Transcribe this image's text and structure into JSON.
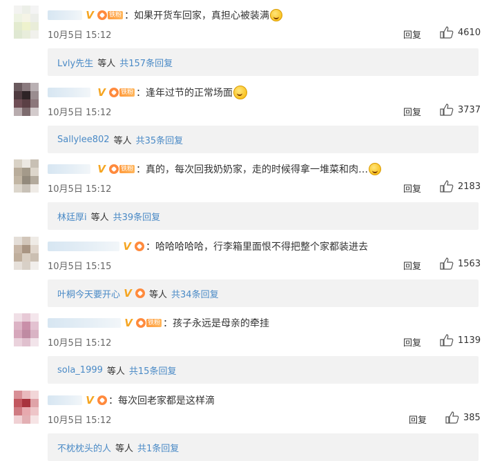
{
  "comments": [
    {
      "text": "：如果开货车回家，真担心被装满",
      "time": "10月5日 15:12",
      "reply_label": "回复",
      "likes": "4610",
      "icons": [
        "verified-v-icon",
        "fan-icon",
        "fan-badge",
        "laugh-cry-emoji-icon"
      ],
      "fan_badge": "铁粉",
      "sub": {
        "user": "Lvly先生",
        "etc": "等人",
        "total": "共157条回复"
      }
    },
    {
      "text": "：逢年过节的正常场面",
      "time": "10月5日 15:12",
      "reply_label": "回复",
      "likes": "3737",
      "icons": [
        "verified-v-icon",
        "fan-icon",
        "fan-badge",
        "smile-emoji-icon"
      ],
      "fan_badge": "铁粉",
      "sub": {
        "user": "Sallylee802",
        "etc": "等人",
        "total": "共35条回复"
      }
    },
    {
      "text": "：真的，每次回我奶奶家，走的时候得拿一堆菜和肉…",
      "time": "10月5日 15:12",
      "reply_label": "回复",
      "likes": "2183",
      "icons": [
        "verified-v-icon",
        "fan-icon",
        "fan-badge",
        "laugh-cry-emoji-icon"
      ],
      "fan_badge": "铁粉",
      "sub": {
        "user": "林廷厚i",
        "etc": "等人",
        "total": "共39条回复"
      }
    },
    {
      "text": "：哈哈哈哈哈，行李箱里面恨不得把整个家都装进去",
      "time": "10月5日 15:15",
      "reply_label": "回复",
      "likes": "1563",
      "icons": [
        "verified-v-icon",
        "fan-icon"
      ],
      "sub": {
        "user": "叶桐今天要开心",
        "etc": "等人",
        "total": "共34条回复"
      }
    },
    {
      "text": "：孩子永远是母亲的牵挂",
      "time": "10月5日 15:12",
      "reply_label": "回复",
      "likes": "1139",
      "icons": [
        "verified-v-icon",
        "fan-icon",
        "fan-badge"
      ],
      "fan_badge": "铁粉",
      "sub": {
        "user": "sola_1999",
        "etc": "等人",
        "total": "共15条回复"
      }
    },
    {
      "text": "：每次回老家都是这样滴",
      "time": "10月5日 15:12",
      "reply_label": "回复",
      "likes": "385",
      "icons": [
        "verified-v-icon",
        "fan-icon"
      ],
      "sub": {
        "user": "不枕枕头的人",
        "etc": "等人",
        "total": "共1条回复"
      }
    }
  ],
  "colors": {
    "link": "#4a8ac6",
    "badge_orange": "#ff9a3c",
    "verified": "#f5a623",
    "subreply_bg": "#f2f2f2"
  }
}
